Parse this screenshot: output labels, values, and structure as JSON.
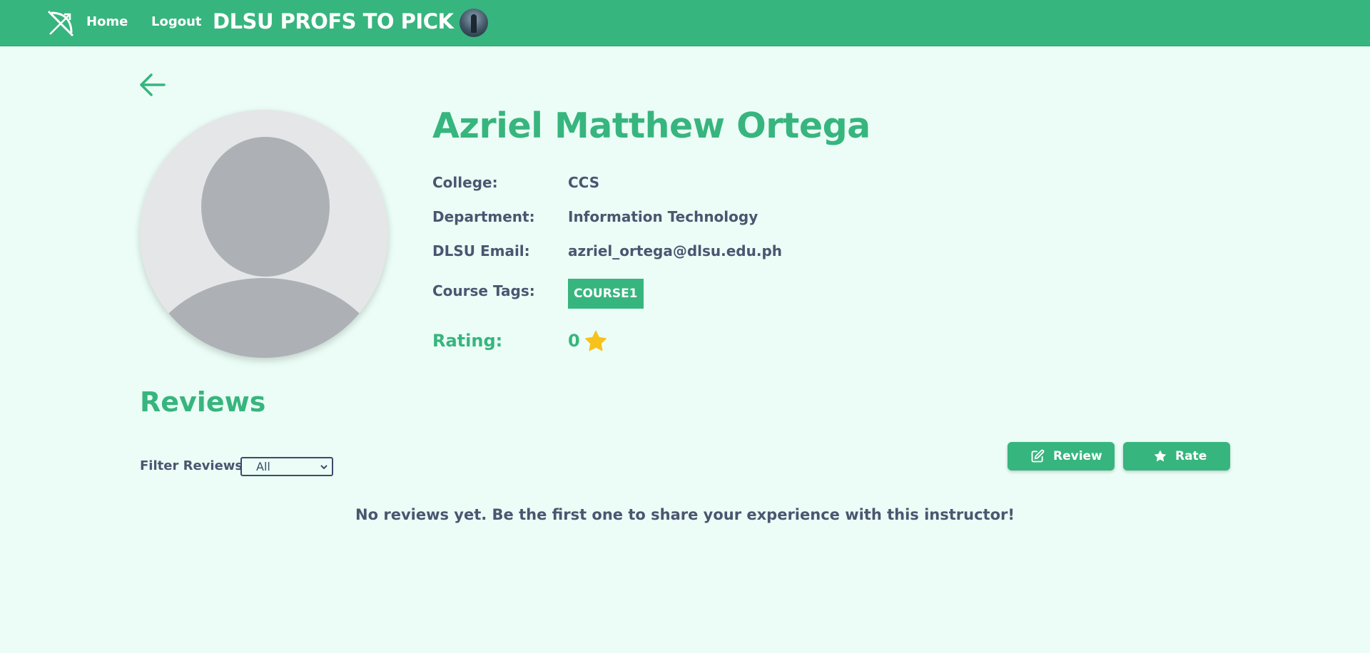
{
  "navbar": {
    "logo_icon": "no-bow-and-arrow-icon",
    "home_label": "Home",
    "logout_label": "Logout",
    "site_title": "DLSU PROFS TO PICK",
    "avatar_icon": "user-avatar-photo"
  },
  "colors": {
    "brand_green": "#37b57e",
    "background": "#ebfdf6",
    "text_slate": "#4a5670",
    "star_yellow": "#f8c21c"
  },
  "profile": {
    "back_icon": "arrow-left-icon",
    "avatar_icon": "default-user-avatar",
    "name": "Azriel Matthew Ortega",
    "college_label": "College:",
    "college_value": "CCS",
    "department_label": "Department:",
    "department_value": "Information Technology",
    "email_label": "DLSU Email:",
    "email_value": "azriel_ortega@dlsu.edu.ph",
    "course_tags_label": "Course Tags:",
    "course_tags": [
      "COURSE1"
    ],
    "rating_label": "Rating:",
    "rating_value": "0",
    "rating_icon": "star-icon"
  },
  "reviews": {
    "heading": "Reviews",
    "filter_label": "Filter Reviews:",
    "filter_selected": "All",
    "review_button_label": "Review",
    "review_button_icon": "edit-icon",
    "rate_button_label": "Rate",
    "rate_button_icon": "star-icon",
    "empty_message": "No reviews yet. Be the first one to share your experience with this instructor!"
  }
}
